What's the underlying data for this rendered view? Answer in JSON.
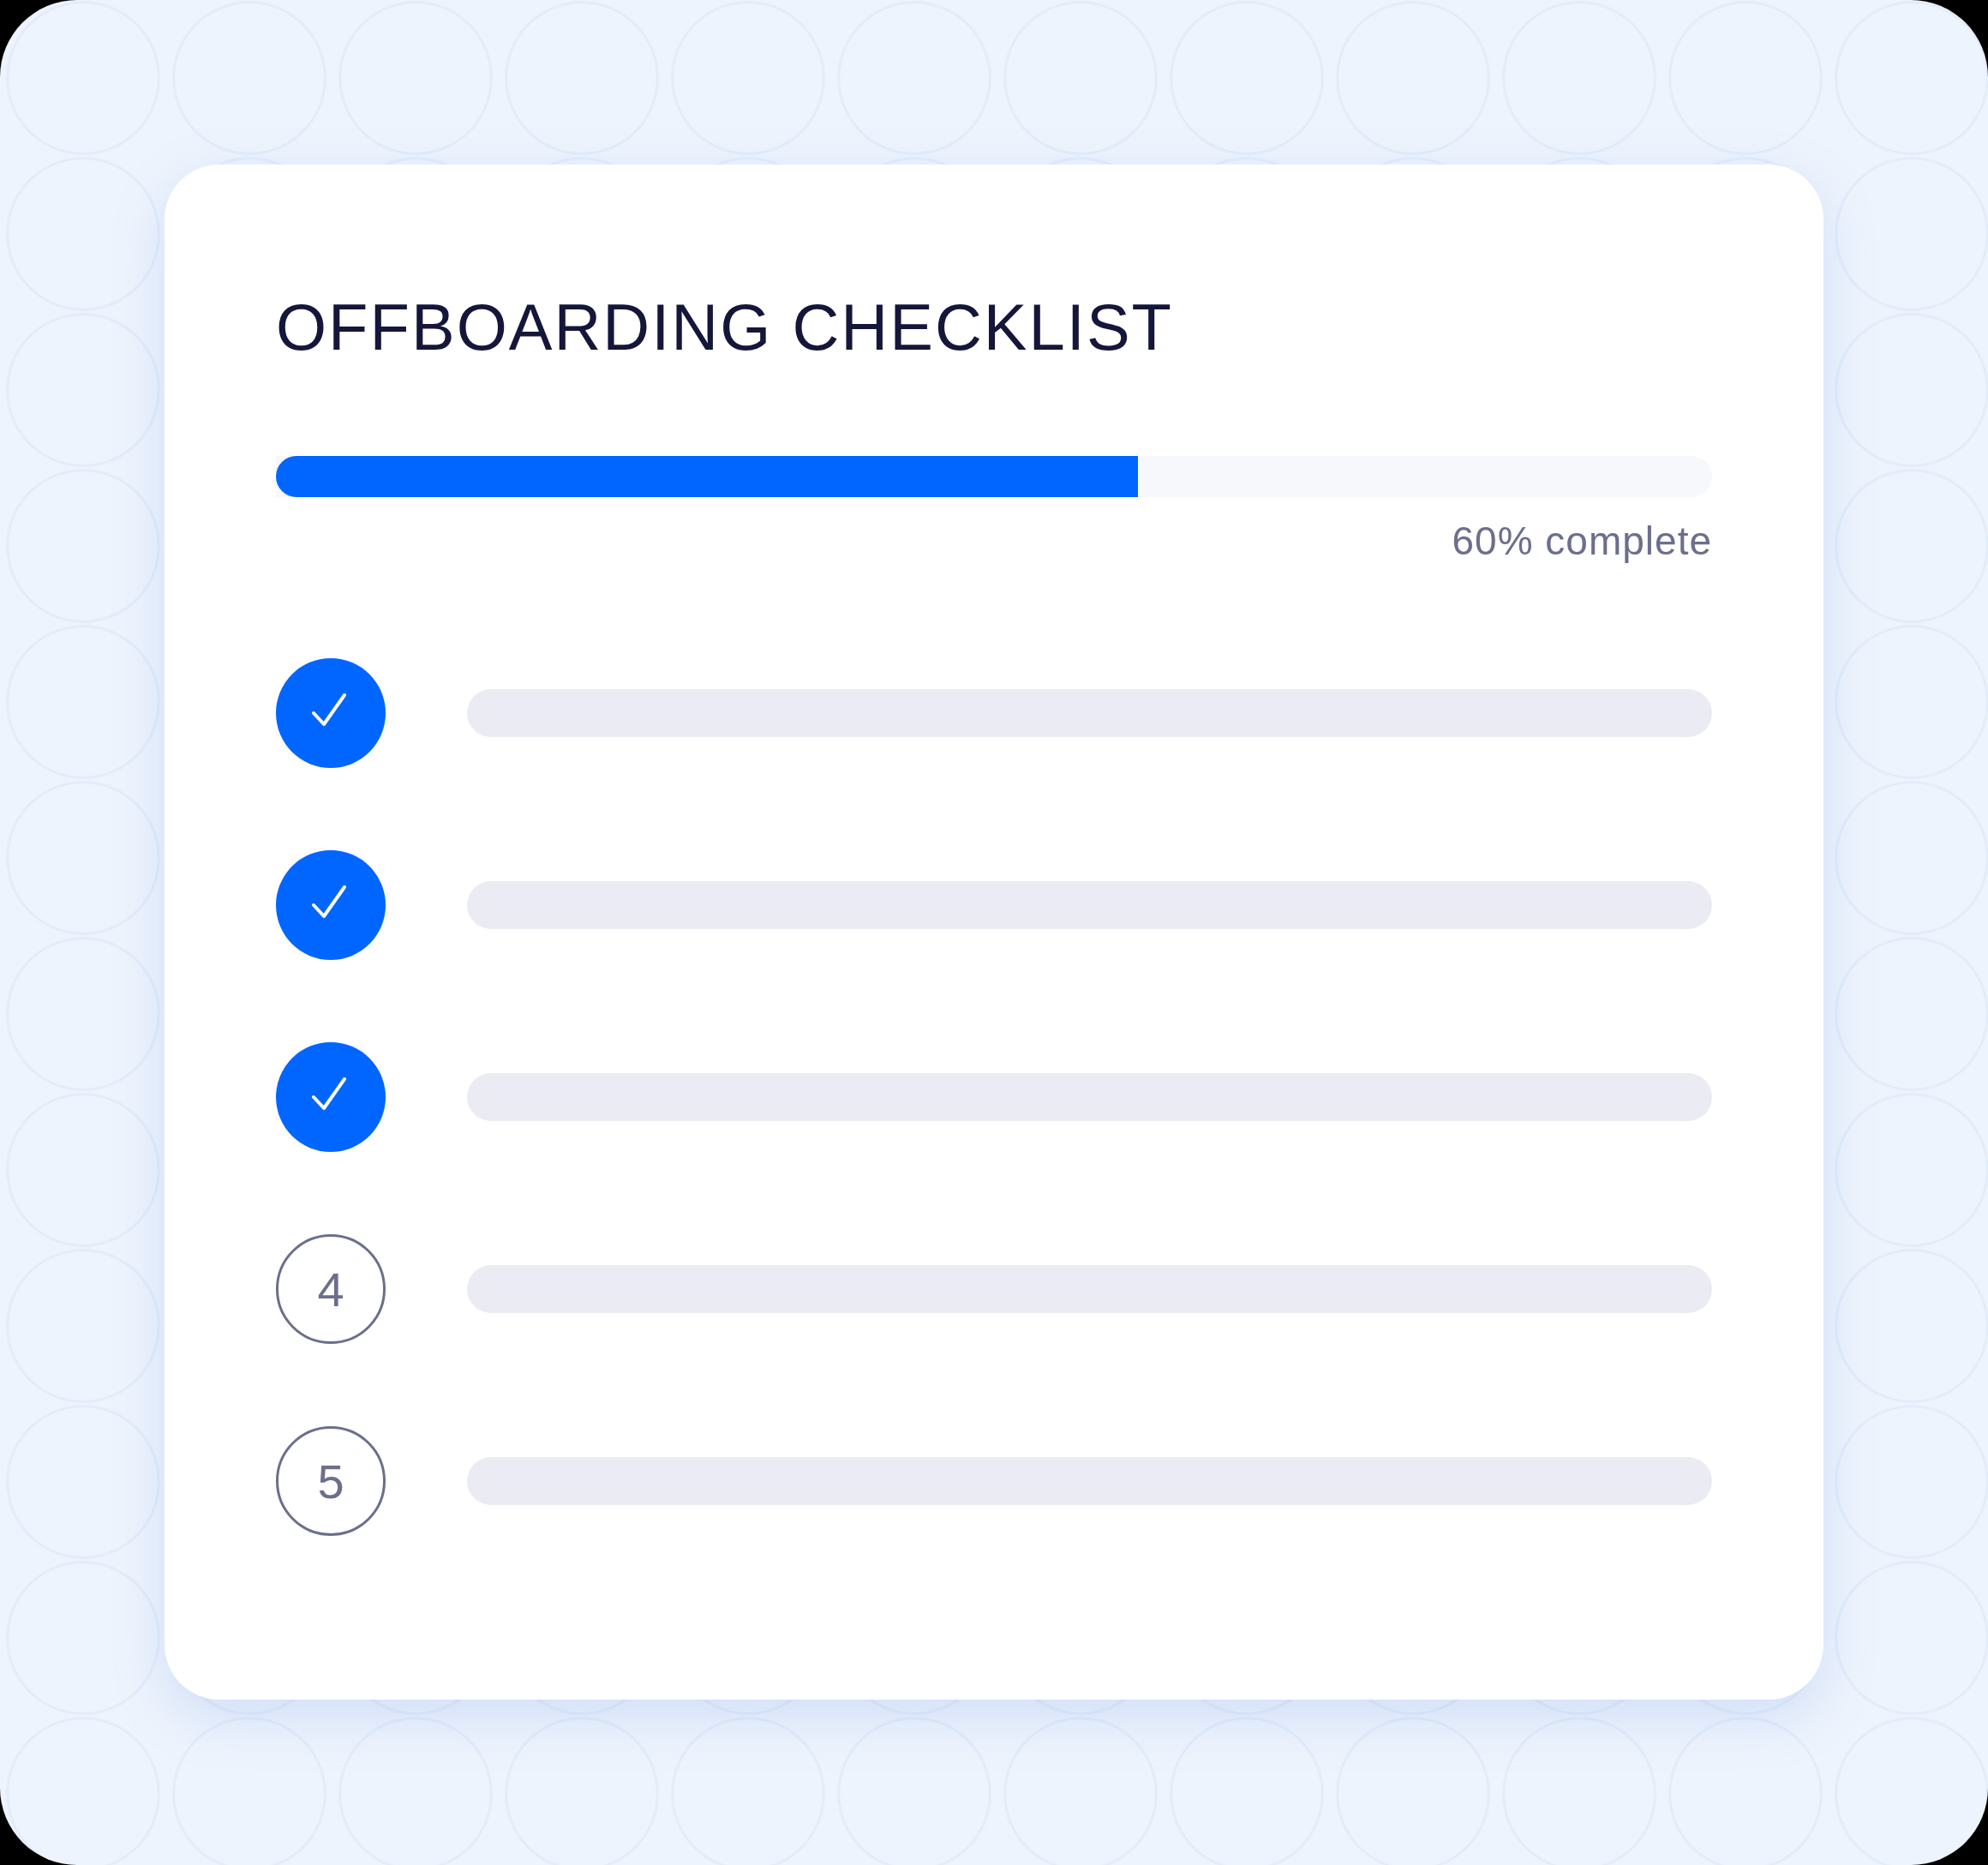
{
  "title": "OFFBOARDING CHECKLIST",
  "progress": {
    "level": 0.6,
    "label": "60% complete"
  },
  "steps": [
    {
      "checked": true
    },
    {
      "checked": true
    },
    {
      "checked": true
    },
    {
      "checked": false,
      "number": "4"
    },
    {
      "checked": false,
      "number": "5"
    }
  ]
}
